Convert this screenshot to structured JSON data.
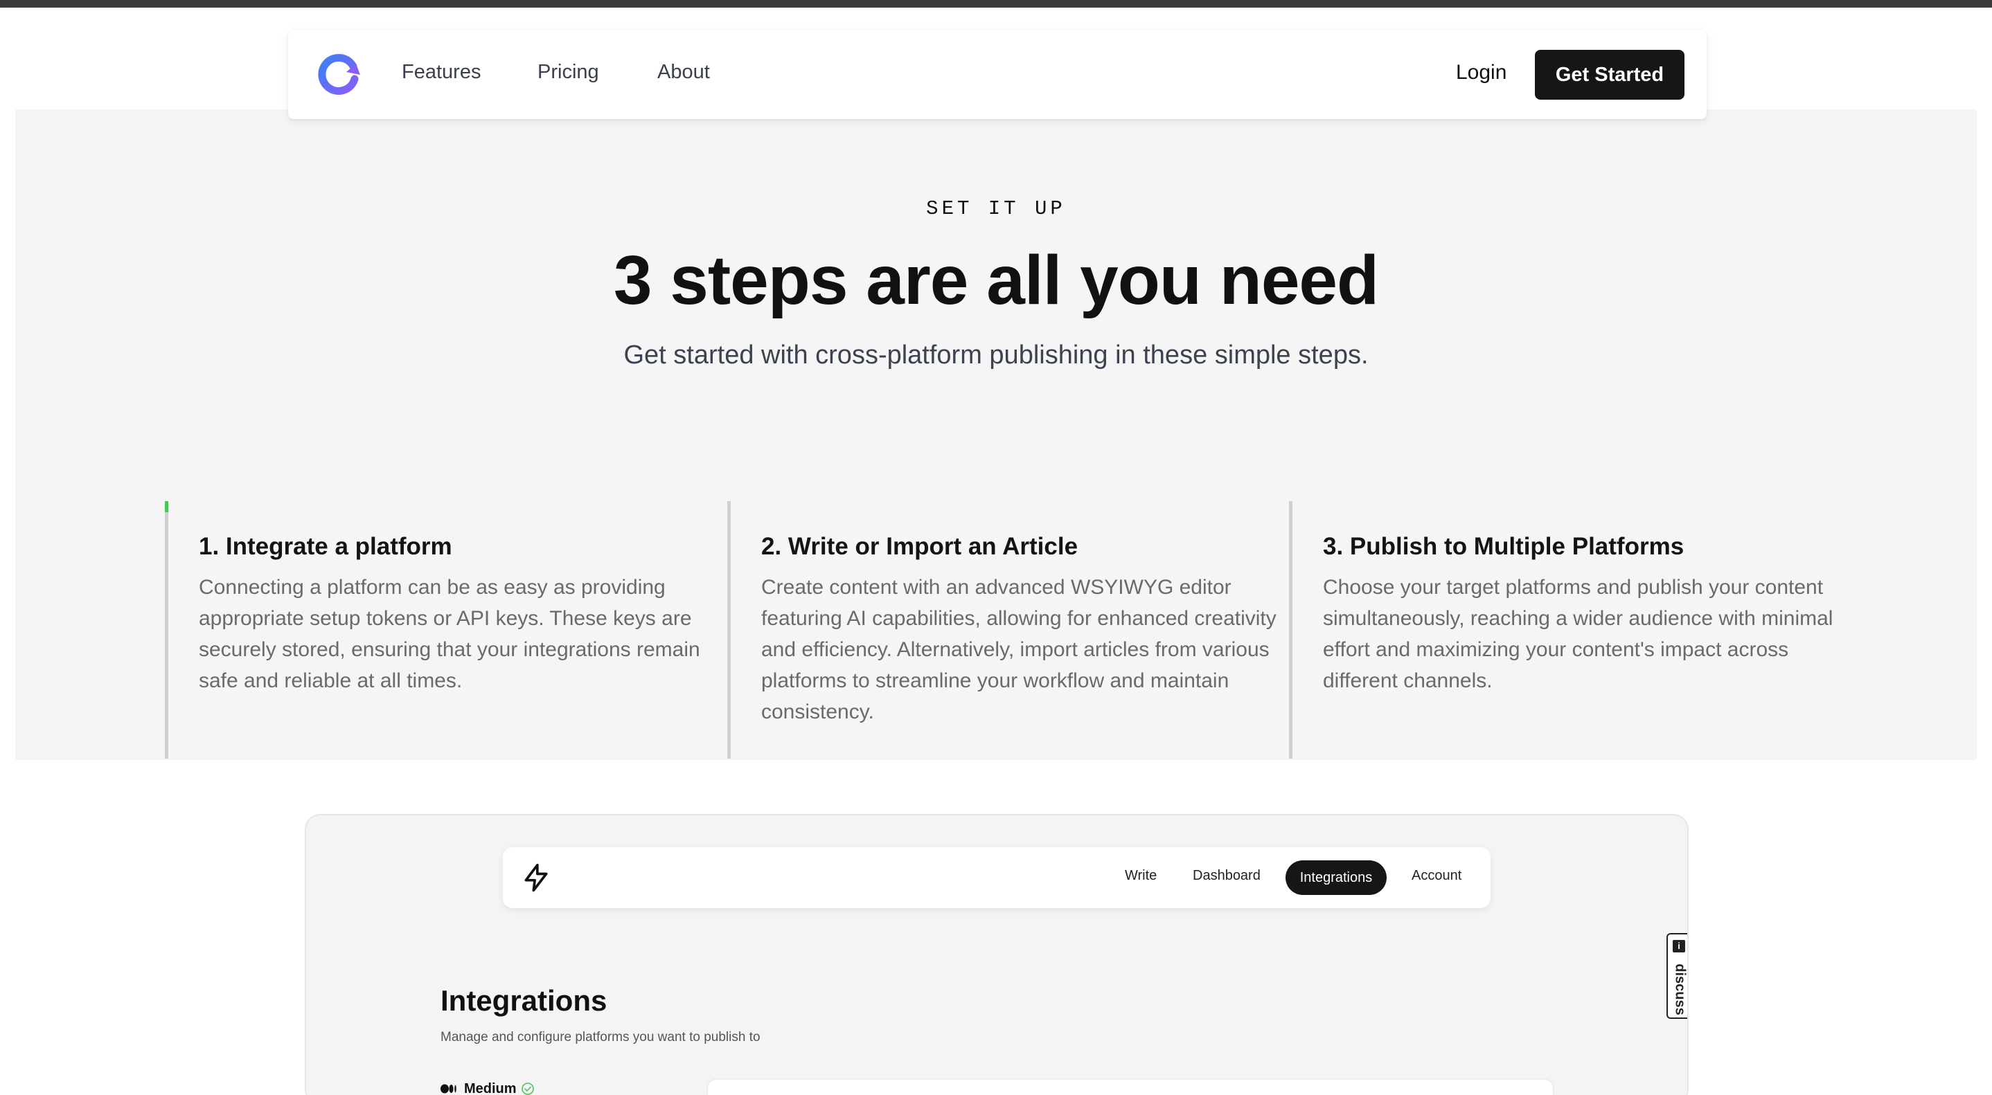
{
  "nav": {
    "links": [
      "Features",
      "Pricing",
      "About"
    ],
    "login_label": "Login",
    "cta_label": "Get Started"
  },
  "hero": {
    "eyebrow": "SET IT UP",
    "title": "3 steps are all you need",
    "subtitle": "Get started with cross-platform publishing in these simple steps."
  },
  "steps": [
    {
      "title": "1. Integrate a platform",
      "description": "Connecting a platform can be as easy as providing appropriate setup tokens or API keys. These keys are securely stored, ensuring that your integrations remain safe and reliable at all times."
    },
    {
      "title": "2. Write or Import an Article",
      "description": "Create content with an advanced WSYIWYG editor featuring AI capabilities, allowing for enhanced creativity and efficiency. Alternatively, import articles from various platforms to streamline your workflow and maintain consistency."
    },
    {
      "title": "3. Publish to Multiple Platforms",
      "description": "Choose your target platforms and publish your content simultaneously, reaching a wider audience with minimal effort and maximizing your content's impact across different channels."
    }
  ],
  "preview": {
    "nav": {
      "write": "Write",
      "dashboard": "Dashboard",
      "integrations": "Integrations",
      "account": "Account"
    },
    "discuss_label": "discuss",
    "discuss_icon_text": "i",
    "integrations_title": "Integrations",
    "integrations_subtitle": "Manage and configure platforms you want to publish to",
    "platform_name": "Medium"
  },
  "colors": {
    "brand_gradient": [
      "#3b82f6",
      "#8b5cf6"
    ],
    "accent_green": "#4cc35b",
    "cta_bg": "#161616"
  },
  "icons": {
    "logo": "refresh-logo-icon",
    "app_logo": "bolt-icon",
    "medium": "medium-logo-icon",
    "check": "check-circle-icon"
  }
}
